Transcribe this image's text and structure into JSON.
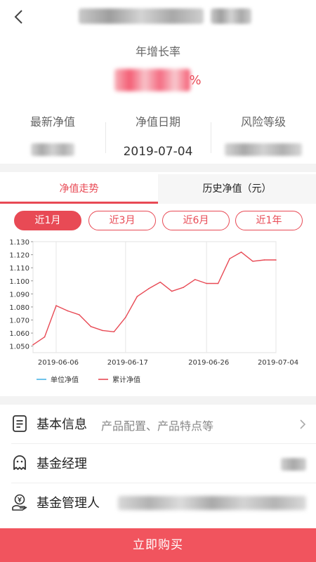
{
  "header": {
    "back_icon": "chevron-left-icon"
  },
  "growth": {
    "label": "年增长率",
    "suffix": "%"
  },
  "stats": [
    {
      "label": "最新净值"
    },
    {
      "label": "净值日期",
      "value": "2019-07-04"
    },
    {
      "label": "风险等级"
    }
  ],
  "tabs": {
    "trend": "净值走势",
    "history": "历史净值（元）"
  },
  "periods": {
    "m1": "近1月",
    "m3": "近3月",
    "m6": "近6月",
    "y1": "近1年",
    "selected": "近1月"
  },
  "chart_data": {
    "type": "line",
    "ylim": [
      1.045,
      1.13
    ],
    "yticks": [
      "1.050",
      "1.060",
      "1.070",
      "1.080",
      "1.090",
      "1.100",
      "1.110",
      "1.120",
      "1.130"
    ],
    "xticks": [
      {
        "label": "2019-06-06",
        "index": 2
      },
      {
        "label": "2019-06-17",
        "index": 8
      },
      {
        "label": "2019-06-26",
        "index": 15
      },
      {
        "label": "2019-07-04",
        "index": 21
      }
    ],
    "series": [
      {
        "name": "单位净值",
        "color": "#4bb4e6",
        "values": []
      },
      {
        "name": "累计净值",
        "color": "#e84a55",
        "values": [
          1.051,
          1.057,
          1.081,
          1.077,
          1.074,
          1.065,
          1.062,
          1.061,
          1.072,
          1.088,
          1.094,
          1.099,
          1.092,
          1.095,
          1.101,
          1.098,
          1.098,
          1.117,
          1.122,
          1.115,
          1.116,
          1.116
        ]
      }
    ],
    "grid": true,
    "legend": "bottom-left"
  },
  "rows": [
    {
      "title": "基本信息",
      "desc": "产品配置、产品特点等",
      "icon": "document-icon"
    },
    {
      "title": "基金经理",
      "icon": "person-icon"
    },
    {
      "title": "基金管理人",
      "icon": "yen-hand-icon"
    }
  ],
  "buy_label": "立即购买",
  "colors": {
    "accent": "#e84a55",
    "button": "#f1545e"
  }
}
